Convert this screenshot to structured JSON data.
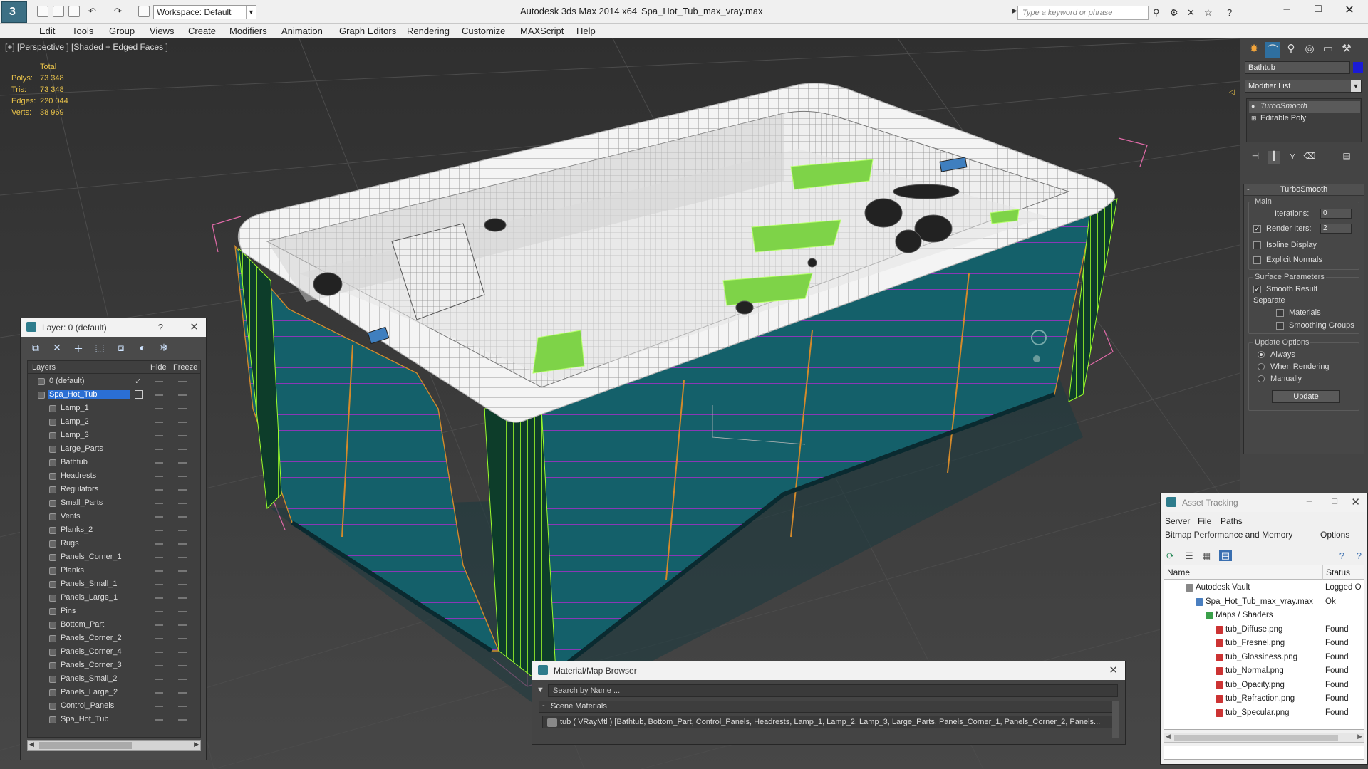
{
  "titlebar": {
    "workspace": "Workspace: Default",
    "app_title": "Autodesk 3ds Max  2014 x64",
    "file_title": "Spa_Hot_Tub_max_vray.max",
    "search_placeholder": "Type a keyword or phrase"
  },
  "menu": [
    "Edit",
    "Tools",
    "Group",
    "Views",
    "Create",
    "Modifiers",
    "Animation",
    "Graph Editors",
    "Rendering",
    "Customize",
    "MAXScript",
    "Help"
  ],
  "viewport": {
    "label": "[+] [Perspective ] [Shaded + Edged Faces ]",
    "stats": {
      "header": "Total",
      "rows": [
        {
          "label": "Polys:",
          "value": "73 348"
        },
        {
          "label": "Tris:",
          "value": "73 348"
        },
        {
          "label": "Edges:",
          "value": "220 044"
        },
        {
          "label": "Verts:",
          "value": "38 969"
        }
      ]
    }
  },
  "layer_panel": {
    "title": "Layer: 0 (default)",
    "help": "?",
    "columns": {
      "layers": "Layers",
      "hide": "Hide",
      "freeze": "Freeze"
    },
    "rows": [
      {
        "name": "0 (default)",
        "check": "✓"
      },
      {
        "name": "Spa_Hot_Tub",
        "check": ""
      },
      {
        "name": "Lamp_1"
      },
      {
        "name": "Lamp_2"
      },
      {
        "name": "Lamp_3"
      },
      {
        "name": "Large_Parts"
      },
      {
        "name": "Bathtub"
      },
      {
        "name": "Headrests"
      },
      {
        "name": "Regulators"
      },
      {
        "name": "Small_Parts"
      },
      {
        "name": "Vents"
      },
      {
        "name": "Planks_2"
      },
      {
        "name": "Rugs"
      },
      {
        "name": "Panels_Corner_1"
      },
      {
        "name": "Planks"
      },
      {
        "name": "Panels_Small_1"
      },
      {
        "name": "Panels_Large_1"
      },
      {
        "name": "Pins"
      },
      {
        "name": "Bottom_Part"
      },
      {
        "name": "Panels_Corner_2"
      },
      {
        "name": "Panels_Corner_4"
      },
      {
        "name": "Panels_Corner_3"
      },
      {
        "name": "Panels_Small_2"
      },
      {
        "name": "Panels_Large_2"
      },
      {
        "name": "Control_Panels"
      },
      {
        "name": "Spa_Hot_Tub"
      }
    ]
  },
  "command_panel": {
    "object_name": "Bathtub",
    "object_color": "#1b1bd6",
    "modifier_list": "Modifier List",
    "stack": [
      "TurboSmooth",
      "Editable Poly"
    ],
    "turbosmooth": {
      "title": "TurboSmooth",
      "main_label": "Main",
      "iterations_label": "Iterations:",
      "iterations_value": "0",
      "render_iters_label": "Render Iters:",
      "render_iters_value": "2",
      "isoline": "Isoline Display",
      "explicit_normals": "Explicit Normals",
      "surface_label": "Surface Parameters",
      "smooth_result": "Smooth Result",
      "separate_label": "Separate",
      "materials": "Materials",
      "smoothing_groups": "Smoothing Groups",
      "update_label": "Update Options",
      "always": "Always",
      "when_rendering": "When Rendering",
      "manually": "Manually",
      "update_button": "Update"
    }
  },
  "asset_tracking": {
    "title": "Asset Tracking",
    "menu": [
      "Server",
      "File",
      "Paths"
    ],
    "menu2": [
      "Bitmap Performance and Memory",
      "Options"
    ],
    "columns": {
      "name": "Name",
      "status": "Status"
    },
    "rows": [
      {
        "name": "Autodesk Vault",
        "status": "Logged O"
      },
      {
        "name": "Spa_Hot_Tub_max_vray.max",
        "status": "Ok"
      },
      {
        "name": "Maps / Shaders",
        "status": ""
      },
      {
        "name": "tub_Diffuse.png",
        "status": "Found"
      },
      {
        "name": "tub_Fresnel.png",
        "status": "Found"
      },
      {
        "name": "tub_Glossiness.png",
        "status": "Found"
      },
      {
        "name": "tub_Normal.png",
        "status": "Found"
      },
      {
        "name": "tub_Opacity.png",
        "status": "Found"
      },
      {
        "name": "tub_Refraction.png",
        "status": "Found"
      },
      {
        "name": "tub_Specular.png",
        "status": "Found"
      }
    ]
  },
  "material_browser": {
    "title": "Material/Map Browser",
    "search_placeholder": "Search by Name ...",
    "section": "Scene Materials",
    "entry": "tub  ( VRayMtl )  [Bathtub, Bottom_Part, Control_Panels, Headrests, Lamp_1, Lamp_2, Lamp_3, Large_Parts, Panels_Corner_1, Panels_Corner_2, Panels..."
  }
}
